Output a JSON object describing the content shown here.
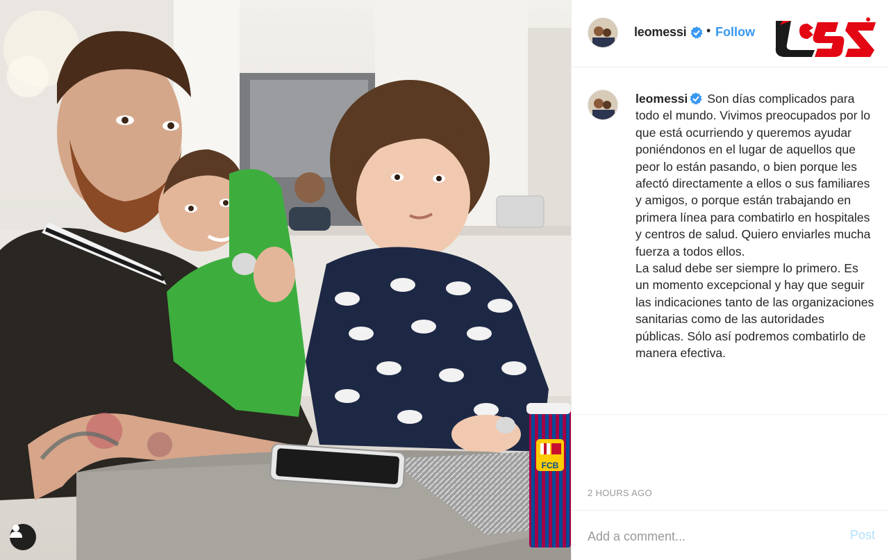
{
  "header": {
    "username": "leomessi",
    "separator": "•",
    "follow_label": "Follow",
    "verified_icon": "verified-badge-icon",
    "logo_icon": "rokna-logo-icon"
  },
  "caption": {
    "username": "leomessi",
    "lines": [
      "Son días complicados para todo el mundo. Vivimos preocupados por lo que está ocurriendo y queremos ayudar poniéndonos en el lugar de aquellos que peor lo están pasando, o bien porque les afectó directamente a ellos o sus familiares y amigos, o porque están trabajando en primera línea para combatirlo en hospitales y centros de salud. Quiero enviarles mucha fuerza a todos ellos.",
      "La salud debe ser siempre lo primero. Es un momento excepcional y hay que seguir las indicaciones tanto de las organizaciones sanitarias como de las autoridades públicas. Sólo así podremos combatirlo de manera efectiva."
    ]
  },
  "timestamp": "2 HOURS AGO",
  "comment": {
    "placeholder": "Add a comment...",
    "post_label": "Post"
  },
  "photo": {
    "tag_icon": "user-tag-icon",
    "cup_text": "FCB"
  },
  "colors": {
    "link_blue": "#3897f0",
    "post_disabled": "#b2dffc",
    "muted": "#999999",
    "logo_red": "#e30613"
  }
}
